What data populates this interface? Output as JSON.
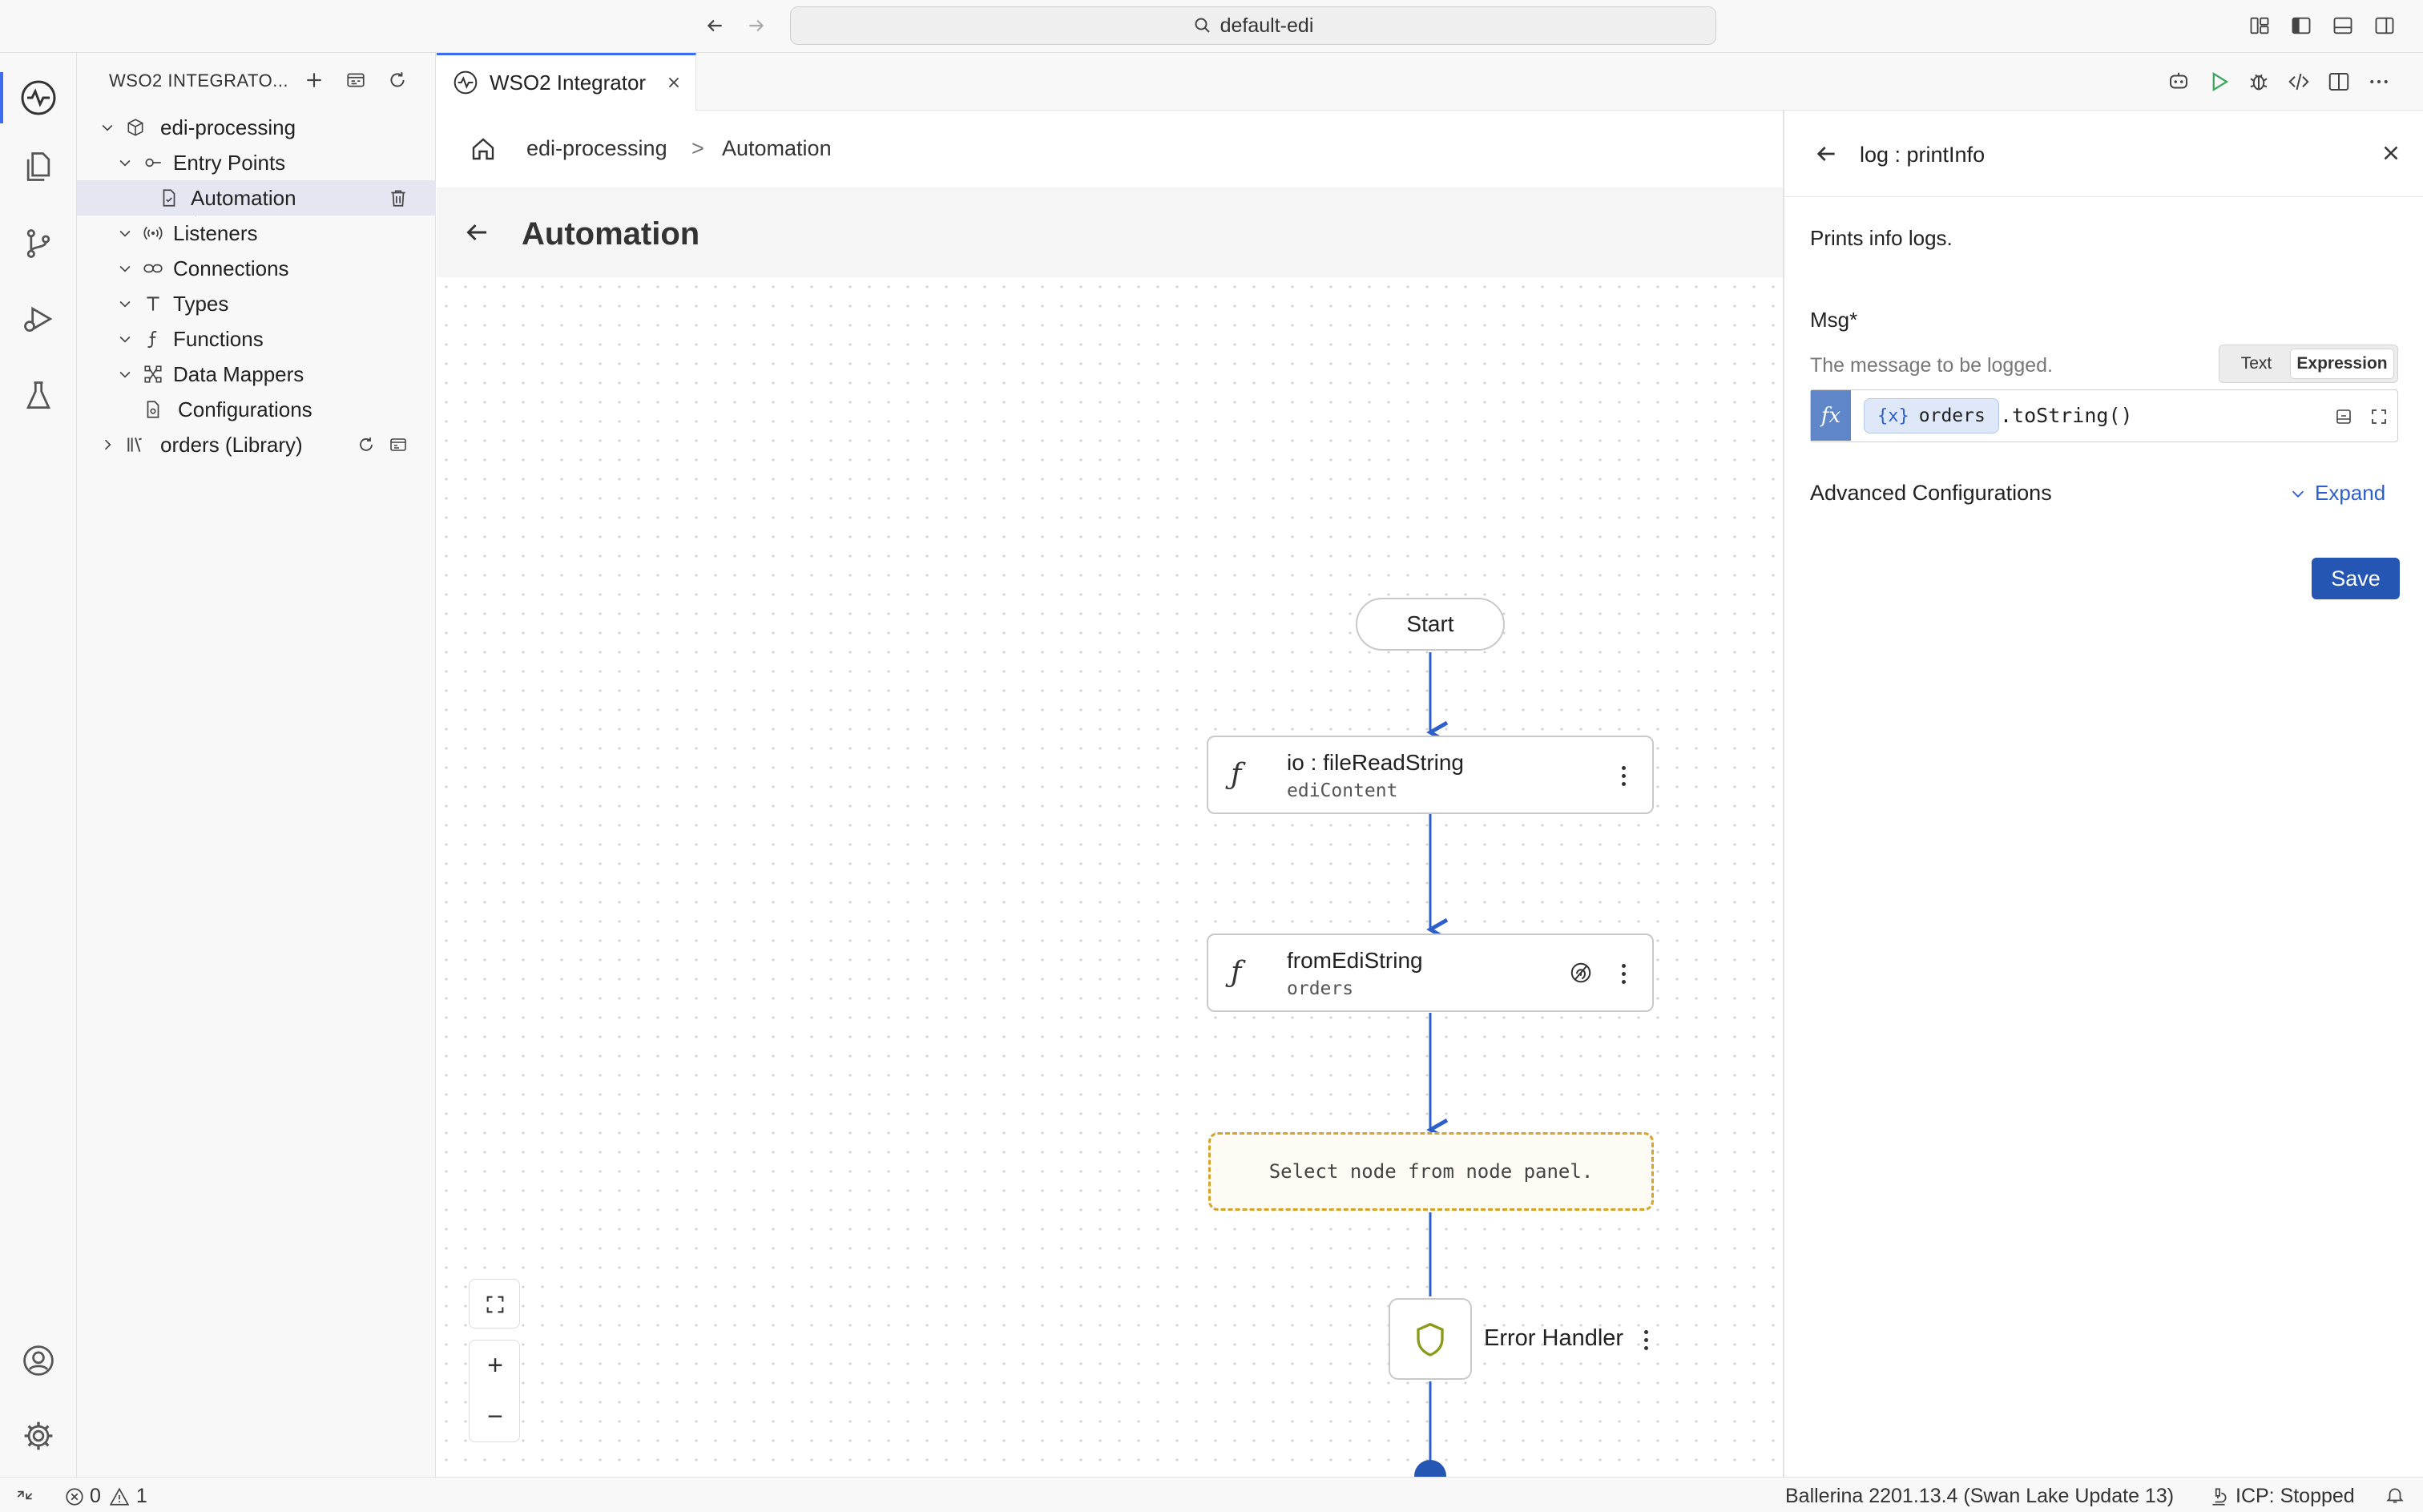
{
  "window": {
    "search_text": "default-edi"
  },
  "explorer": {
    "header": "WSO2 INTEGRATO...",
    "project": "edi-processing",
    "items": {
      "entry_points": "Entry Points",
      "automation": "Automation",
      "listeners": "Listeners",
      "connections": "Connections",
      "types": "Types",
      "functions": "Functions",
      "data_mappers": "Data Mappers",
      "configurations": "Configurations",
      "library": "orders (Library)"
    }
  },
  "editor": {
    "tab_label": "WSO2 Integrator"
  },
  "breadcrumb": {
    "project": "edi-processing",
    "separator": ">",
    "current": "Automation"
  },
  "page": {
    "title": "Automation"
  },
  "flow": {
    "start": "Start",
    "nodes": [
      {
        "title": "io : fileReadString",
        "variable": "ediContent"
      },
      {
        "title": "fromEdiString",
        "variable": "orders"
      }
    ],
    "placeholder": "Select node from node panel.",
    "error_handler": "Error Handler"
  },
  "zoom": {
    "in": "+",
    "out": "−"
  },
  "panel": {
    "title": "log : printInfo",
    "description": "Prints info logs.",
    "field_label": "Msg*",
    "field_hint": "The message to be logged.",
    "mode_text": "Text",
    "mode_expression": "Expression",
    "active_mode": "Expression",
    "fx_symbol": "fx",
    "chip_prefix": "{x}",
    "chip_var": "orders",
    "expression_rest": ".toString()",
    "advanced_label": "Advanced Configurations",
    "expand_label": "Expand",
    "save_label": "Save"
  },
  "status": {
    "errors": "0",
    "warnings": "1",
    "ballerina": "Ballerina 2201.13.4 (Swan Lake Update 13)",
    "icp": "ICP: Stopped"
  },
  "colors": {
    "accent": "#2556b3",
    "flow_line": "#2c5ecc",
    "placeholder_border": "#d4a52a",
    "error_shield": "#8a9a1a"
  }
}
